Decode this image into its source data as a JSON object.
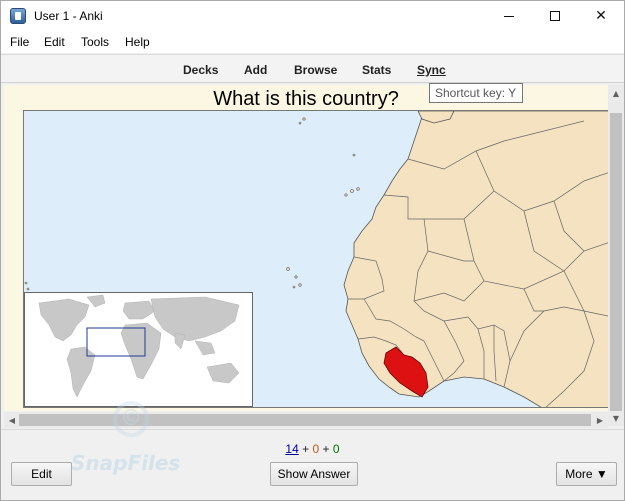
{
  "window": {
    "title": "User 1 - Anki"
  },
  "menu": [
    "File",
    "Edit",
    "Tools",
    "Help"
  ],
  "toolbar": {
    "decks": "Decks",
    "add": "Add",
    "browse": "Browse",
    "stats": "Stats",
    "sync": "Sync"
  },
  "tooltip": "Shortcut key: Y",
  "card": {
    "question": "What is this country?",
    "highlighted_country": "Liberia",
    "highlight_color": "#dd1111",
    "land_color": "#f4e2c1",
    "sea_color": "#ddeefa"
  },
  "counts": {
    "new": "14",
    "plus1": "+",
    "learning": "0",
    "plus2": "+",
    "review": "0"
  },
  "buttons": {
    "edit": "Edit",
    "show_answer": "Show Answer",
    "more": "More ▼"
  },
  "watermark": "SnapFiles"
}
